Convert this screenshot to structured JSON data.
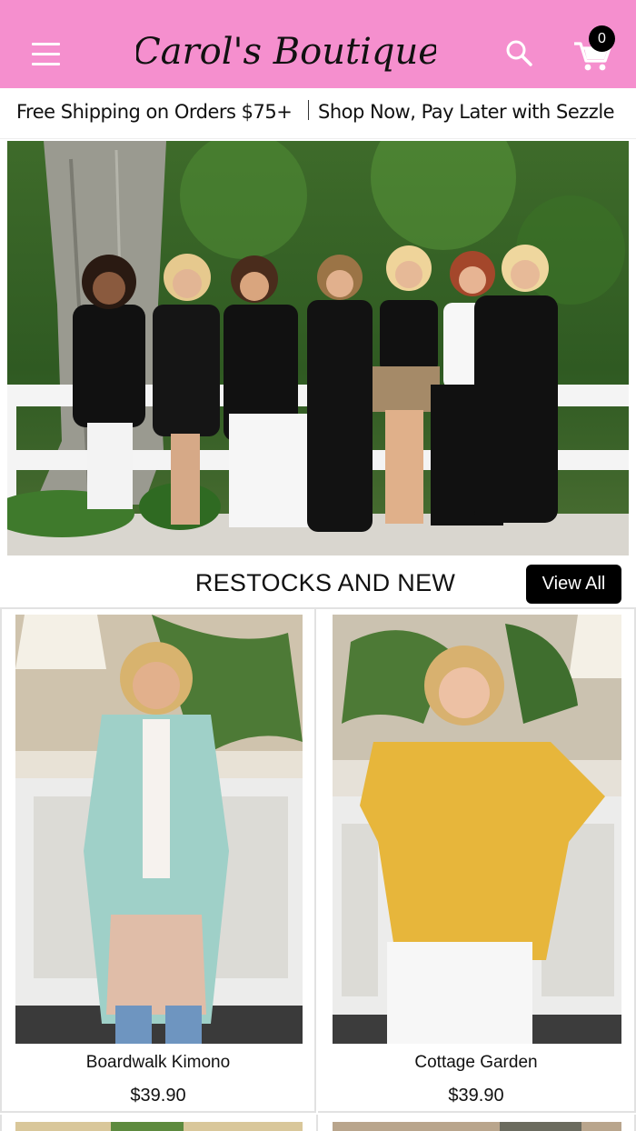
{
  "header": {
    "brand": "Carol's Boutique",
    "cart_count": "0",
    "colors": {
      "pink": "#f58fce",
      "black": "#000000"
    }
  },
  "promo": {
    "shipping": "Free Shipping on Orders $75+",
    "sezzle": "Shop Now, Pay Later with Sezzle"
  },
  "section": {
    "title": "RESTOCKS AND NEW",
    "view_all": "View All"
  },
  "products": [
    {
      "name": "Boardwalk Kimono",
      "price": "$39.90"
    },
    {
      "name": "Cottage Garden",
      "price": "$39.90"
    }
  ]
}
